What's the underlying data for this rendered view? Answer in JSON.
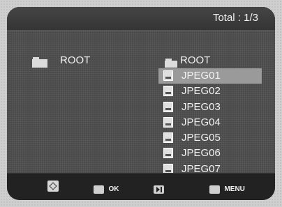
{
  "header": {
    "total": "Total : 1/3"
  },
  "left_panel": {
    "folder_label": "ROOT"
  },
  "right_panel": {
    "folder_label": "ROOT",
    "files": [
      "JPEG01",
      "JPEG02",
      "JPEG03",
      "JPEG04",
      "JPEG05",
      "JPEG06",
      "JPEG07"
    ],
    "selected_index": 0
  },
  "footer": {
    "nav_icon": "direction-pad-icon",
    "ok_label": "OK",
    "play_icon": "play-pause-icon",
    "menu_label": "MENU"
  },
  "colors": {
    "header_bg": "#3d3d3d",
    "panel_bg": "#4a4a4a",
    "selection": "#9a9a9a",
    "text": "#f2f2f2"
  }
}
